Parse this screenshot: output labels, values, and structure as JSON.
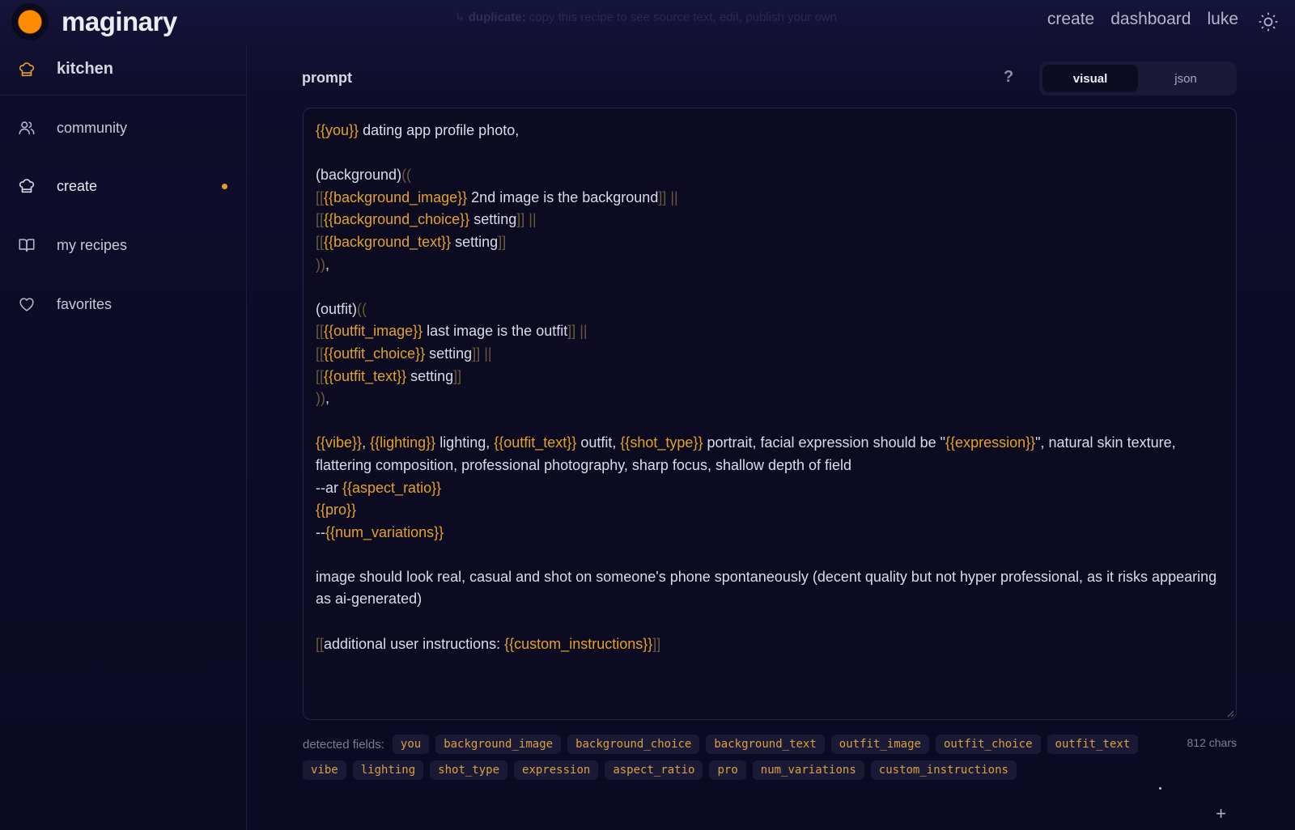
{
  "app": {
    "name": "maginary"
  },
  "header": {
    "hint_bold": "duplicate:",
    "hint_text": " copy this recipe to see source text, edit, publish your own",
    "nav": [
      "create",
      "dashboard",
      "luke"
    ]
  },
  "sidebar": {
    "header_label": "kitchen",
    "items": [
      {
        "label": "community",
        "icon": "users-icon"
      },
      {
        "label": "create",
        "icon": "chef-hat-icon",
        "active": true
      },
      {
        "label": "my recipes",
        "icon": "book-icon"
      },
      {
        "label": "favorites",
        "icon": "heart-icon"
      }
    ]
  },
  "editor": {
    "title": "prompt",
    "help": "?",
    "modes": [
      "visual",
      "json"
    ],
    "active_mode": "visual",
    "content": "{{you}} dating app profile photo,\n\n(background)((\n[[{{background_image}} 2nd image is the background]] ||\n[[{{background_choice}} setting]] ||\n[[{{background_text}} setting]]\n)),\n\n(outfit)((\n[[{{outfit_image}} last image is the outfit]] ||\n[[{{outfit_choice}} setting]] ||\n[[{{outfit_text}} setting]]\n)),\n\n{{vibe}}, {{lighting}} lighting, {{outfit_text}} outfit, {{shot_type}} portrait, facial expression should be \"{{expression}}\", natural skin texture, flattering composition, professional photography, sharp focus, shallow depth of field\n--ar {{aspect_ratio}}\n{{pro}}\n--{{num_variations}}\n\nimage should look real, casual and shot on someone's phone spontaneously (decent quality but not hyper professional, as it risks appearing as ai-generated)\n\n[[additional user instructions: {{custom_instructions}}]]"
  },
  "fields": {
    "label": "detected fields:",
    "chars": "812 chars",
    "row1": [
      "you",
      "background_image",
      "background_choice",
      "background_text",
      "outfit_image",
      "outfit_choice",
      "outfit_text"
    ],
    "row2": [
      "vibe",
      "lighting",
      "shot_type",
      "expression",
      "aspect_ratio",
      "pro",
      "num_variations",
      "custom_instructions"
    ]
  },
  "actions": {
    "add": "+"
  },
  "colors": {
    "accent": "#ff8a00",
    "variable": "#e3a22a",
    "background": "#0c0b24"
  }
}
